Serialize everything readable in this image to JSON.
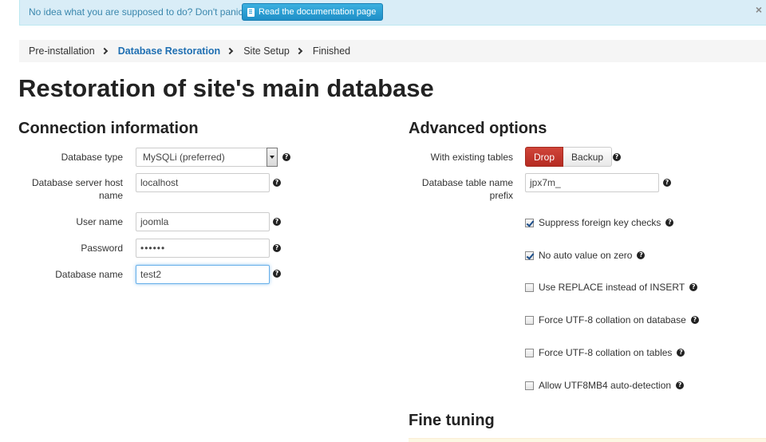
{
  "alert": {
    "text": "No idea what you are supposed to do? Don't panic!",
    "button_label": "Read the documentation page",
    "close_glyph": "×"
  },
  "breadcrumb": {
    "items": [
      "Pre-installation",
      "Database Restoration",
      "Site Setup",
      "Finished"
    ],
    "active_index": 1
  },
  "page": {
    "title": "Restoration of site's main database"
  },
  "connection": {
    "heading": "Connection information",
    "db_type_label": "Database type",
    "db_type_value": "MySQLi (preferred)",
    "host_label_line1": "Database server host",
    "host_label_line2": "name",
    "host_value": "localhost",
    "user_label": "User name",
    "user_value": "joomla",
    "password_label": "Password",
    "password_value": "••••••",
    "dbname_label": "Database name",
    "dbname_value": "test2"
  },
  "advanced": {
    "heading": "Advanced options",
    "existing_label": "With existing tables",
    "drop_label": "Drop",
    "backup_label": "Backup",
    "prefix_label_line1": "Database table name",
    "prefix_label_line2": "prefix",
    "prefix_value": "jpx7m_",
    "options": [
      {
        "label": "Suppress foreign key checks",
        "checked": true
      },
      {
        "label": "No auto value on zero",
        "checked": true
      },
      {
        "label": "Use REPLACE instead of INSERT",
        "checked": false
      },
      {
        "label": "Force UTF-8 collation on database",
        "checked": false
      },
      {
        "label": "Force UTF-8 collation on tables",
        "checked": false
      },
      {
        "label": "Allow UTF8MB4 auto-detection",
        "checked": false
      }
    ]
  },
  "fine_tuning": {
    "heading": "Fine tuning"
  },
  "help_glyph": "?",
  "colors": {
    "alert_bg": "#d9edf7",
    "link_blue": "#1f6fb2",
    "drop_red": "#c0392b",
    "info_button": "#2a9fd6"
  }
}
